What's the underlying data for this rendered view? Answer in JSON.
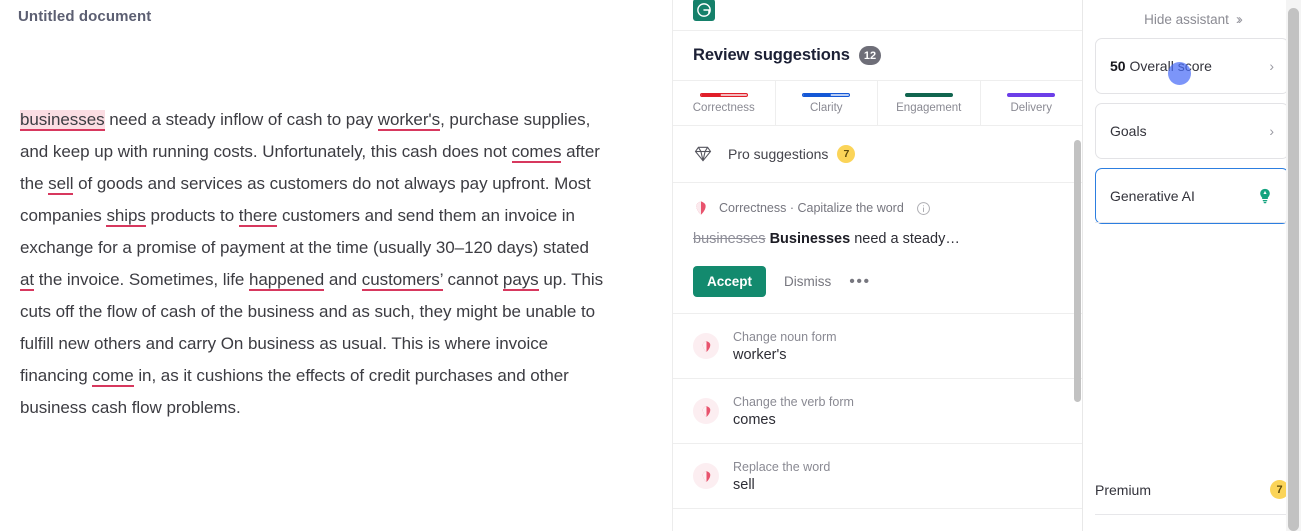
{
  "document": {
    "title": "Untitled document",
    "paragraph_parts": [
      {
        "text": "businesses",
        "style": "highlight-correctness"
      },
      {
        "text": " need a steady inflow of cash to pay ",
        "style": "plain"
      },
      {
        "text": "worker's",
        "style": "error"
      },
      {
        "text": ", purchase supplies, and keep up with running costs. Unfortunately, this cash does not ",
        "style": "plain"
      },
      {
        "text": "comes",
        "style": "error"
      },
      {
        "text": " after the ",
        "style": "plain"
      },
      {
        "text": "sell",
        "style": "error"
      },
      {
        "text": " of goods and services as customers do not always pay upfront. Most companies ",
        "style": "plain"
      },
      {
        "text": "ships",
        "style": "error"
      },
      {
        "text": " products to ",
        "style": "plain"
      },
      {
        "text": "there",
        "style": "error"
      },
      {
        "text": " customers and send them an invoice in exchange for a promise of payment at the time (usually 30–120 days) stated ",
        "style": "plain"
      },
      {
        "text": "at",
        "style": "error"
      },
      {
        "text": " the invoice. Sometimes, life ",
        "style": "plain"
      },
      {
        "text": "happened",
        "style": "error"
      },
      {
        "text": " and ",
        "style": "plain"
      },
      {
        "text": "customers’",
        "style": "error"
      },
      {
        "text": " cannot ",
        "style": "plain"
      },
      {
        "text": "pays",
        "style": "error"
      },
      {
        "text": " up. This cuts off the flow of cash of the business and as such, they might be unable to fulfill new others and carry On business as usual. This is where invoice financing ",
        "style": "plain"
      },
      {
        "text": "come",
        "style": "error"
      },
      {
        "text": " in, as it cushions the effects of credit purchases and other business cash flow problems.",
        "style": "plain"
      }
    ]
  },
  "assistant": {
    "logo_name": "grammarly-logo",
    "heading": "Review suggestions",
    "suggestion_count": "12",
    "categories": [
      {
        "label": "Correctness",
        "color": "#e01e29",
        "fill_percent": 45,
        "track": "#f4bcbf"
      },
      {
        "label": "Clarity",
        "color": "#1558d6",
        "fill_percent": 60,
        "track": "#b9cdf4"
      },
      {
        "label": "Engagement",
        "color": "#11654f",
        "fill_percent": 100,
        "track": "#11654f"
      },
      {
        "label": "Delivery",
        "color": "#6c3ee8",
        "fill_percent": 100,
        "track": "#6c3ee8"
      }
    ],
    "pro": {
      "label": "Pro suggestions",
      "count": "7",
      "icon": "diamond-icon"
    },
    "active_card": {
      "category": "Correctness · Capitalize the word",
      "info_icon": "info-icon",
      "original": "businesses",
      "replacement": "Businesses",
      "context_suffix": " need a steady…",
      "accept_label": "Accept",
      "dismiss_label": "Dismiss",
      "more_label": "•••"
    },
    "suggestions": [
      {
        "kind": "Change noun form",
        "word": "worker's"
      },
      {
        "kind": "Change the verb form",
        "word": "comes"
      },
      {
        "kind": "Replace the word",
        "word": "sell"
      }
    ]
  },
  "sidebar": {
    "hide_assistant": "Hide assistant",
    "hide_assistant_icon": "chevron-double-right-icon",
    "cards": [
      {
        "score": "50",
        "label": " Overall score",
        "icon": "chevron-right-icon",
        "selected": false,
        "name": "overall-score"
      },
      {
        "score": "",
        "label": "Goals",
        "icon": "chevron-right-icon",
        "selected": false,
        "name": "goals"
      },
      {
        "score": "",
        "label": "Generative AI",
        "icon": "lightbulb-icon",
        "selected": true,
        "name": "generative-ai"
      }
    ],
    "premium": {
      "label": "Premium",
      "count": "7"
    }
  }
}
